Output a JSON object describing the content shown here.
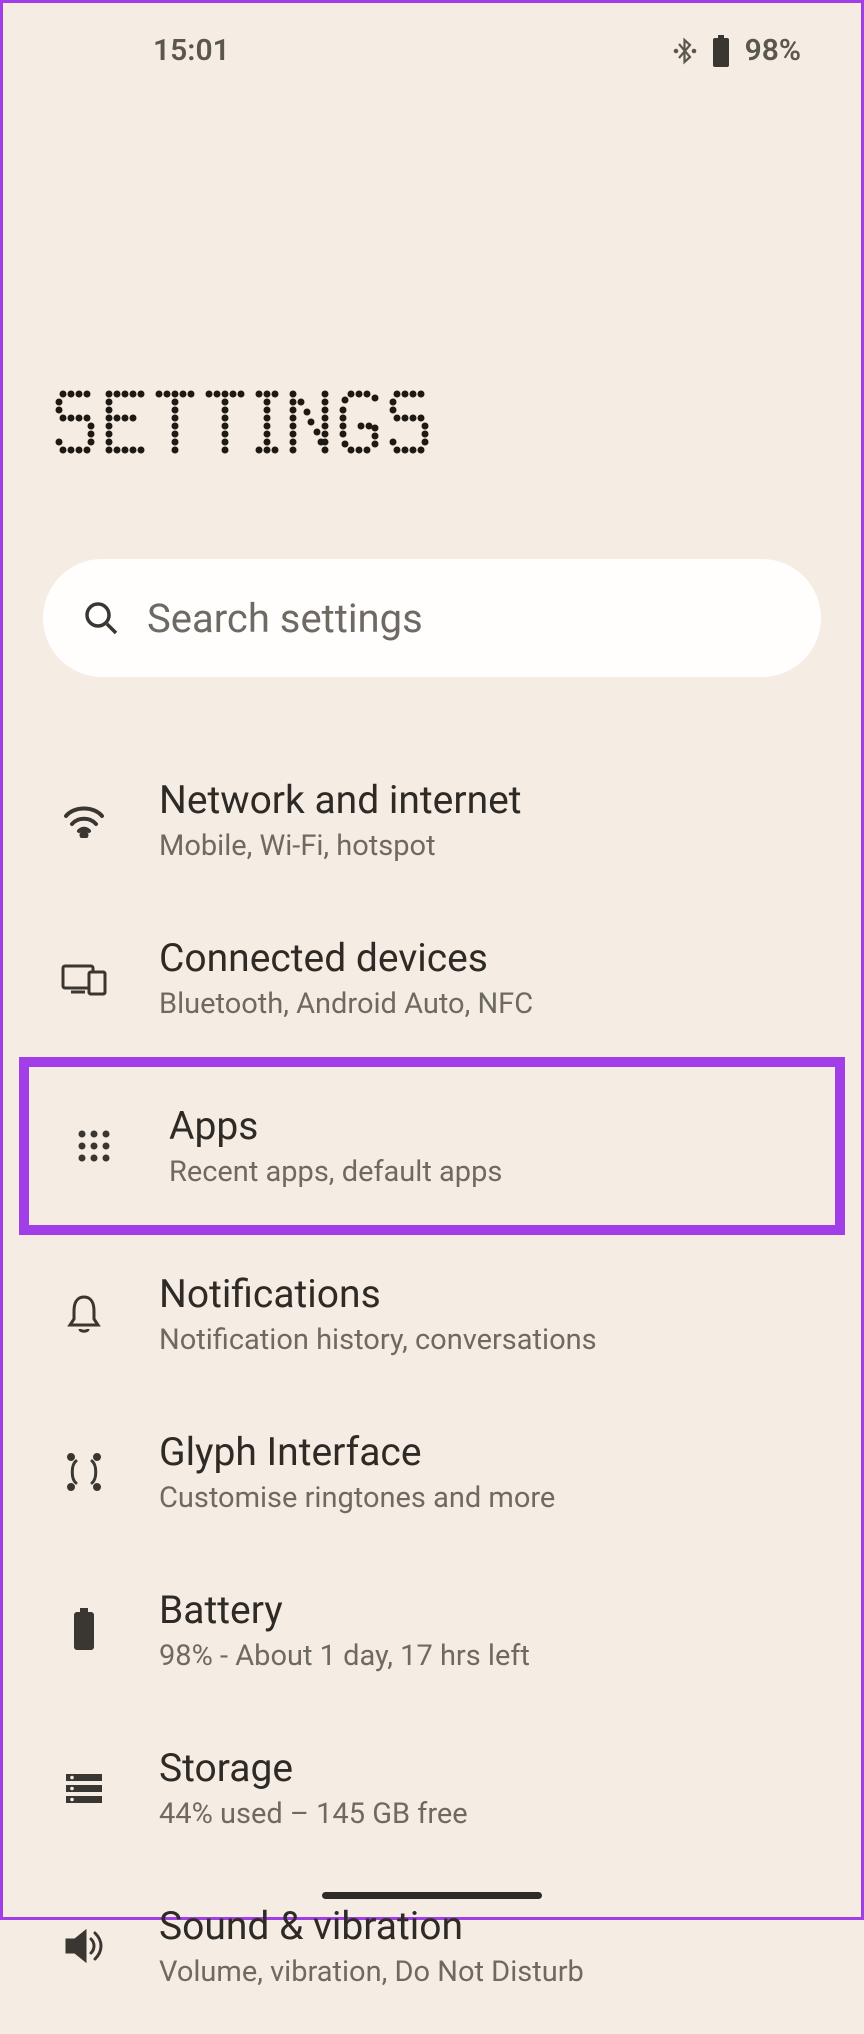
{
  "status": {
    "time": "15:01",
    "battery_pct": "98%"
  },
  "page": {
    "title": "SETTINGS"
  },
  "search": {
    "placeholder": "Search settings"
  },
  "items": [
    {
      "title": "Network and internet",
      "subtitle": "Mobile, Wi-Fi, hotspot"
    },
    {
      "title": "Connected devices",
      "subtitle": "Bluetooth, Android Auto, NFC"
    },
    {
      "title": "Apps",
      "subtitle": "Recent apps, default apps"
    },
    {
      "title": "Notifications",
      "subtitle": "Notification history, conversations"
    },
    {
      "title": "Glyph Interface",
      "subtitle": "Customise ringtones and more"
    },
    {
      "title": "Battery",
      "subtitle": "98% - About 1 day, 17 hrs left"
    },
    {
      "title": "Storage",
      "subtitle": "44% used – 145 GB free"
    },
    {
      "title": "Sound & vibration",
      "subtitle": "Volume, vibration, Do Not Disturb"
    }
  ]
}
